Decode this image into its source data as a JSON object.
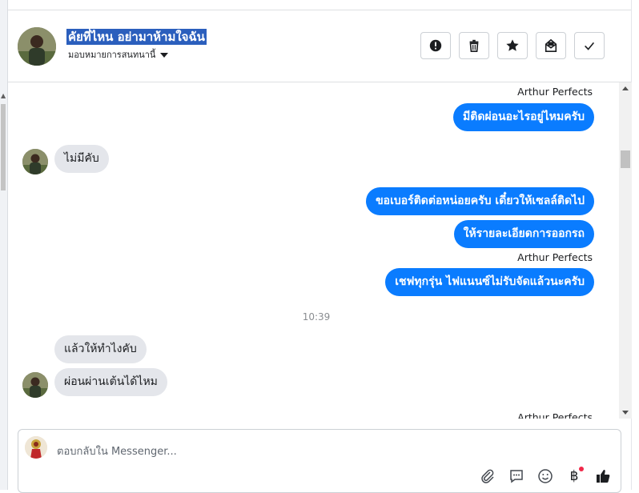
{
  "header": {
    "name": "คัยที่ไหน อย่ามาห้ามใจฉัน",
    "assign_label": "มอบหมายการสนทนานี้",
    "actions": [
      {
        "icon": "exclamation-circle-icon",
        "label": "Report"
      },
      {
        "icon": "trash-icon",
        "label": "Delete"
      },
      {
        "icon": "star-icon",
        "label": "Star"
      },
      {
        "icon": "envelope-icon",
        "label": "Mark unread"
      },
      {
        "icon": "check-icon",
        "label": "Done"
      }
    ]
  },
  "thread": {
    "messages": [
      {
        "type": "sender",
        "text": "Arthur Perfects"
      },
      {
        "type": "out",
        "text": "มีติดผ่อนอะไรอยู่ไหมครับ"
      },
      {
        "type": "in",
        "text": "ไม่มีคับ",
        "avatar": true
      },
      {
        "type": "out",
        "text": "ขอเบอร์ติดต่อหน่อยครับ เดี๋ยวให้เซลล์ติดไป"
      },
      {
        "type": "out",
        "text": "ให้รายละเอียดการออกรถ"
      },
      {
        "type": "sender",
        "text": "Arthur Perfects"
      },
      {
        "type": "out",
        "text": "เชฟทุกรุ่น ไฟแนนซ์ไม่รับจัดแล้วนะครับ"
      },
      {
        "type": "time",
        "text": "10:39"
      },
      {
        "type": "in",
        "text": "แล้วให้ทำไงคับ"
      },
      {
        "type": "in",
        "text": "ผ่อนผ่านเต้นได้ไหม",
        "avatar": true
      },
      {
        "type": "sender",
        "text": "Arthur Perfects"
      }
    ]
  },
  "composer": {
    "placeholder": "ตอบกลับใน Messenger...",
    "tools": [
      "paperclip-icon",
      "chat-bubble-icon",
      "smiley-icon",
      "baht-icon",
      "thumbs-up-icon"
    ],
    "baht_symbol": "฿"
  },
  "colors": {
    "outgoing_bubble": "#0a7cff",
    "incoming_bubble": "#e4e6eb",
    "name_highlight": "#2b5fbd",
    "notification_dot": "#f02849"
  }
}
